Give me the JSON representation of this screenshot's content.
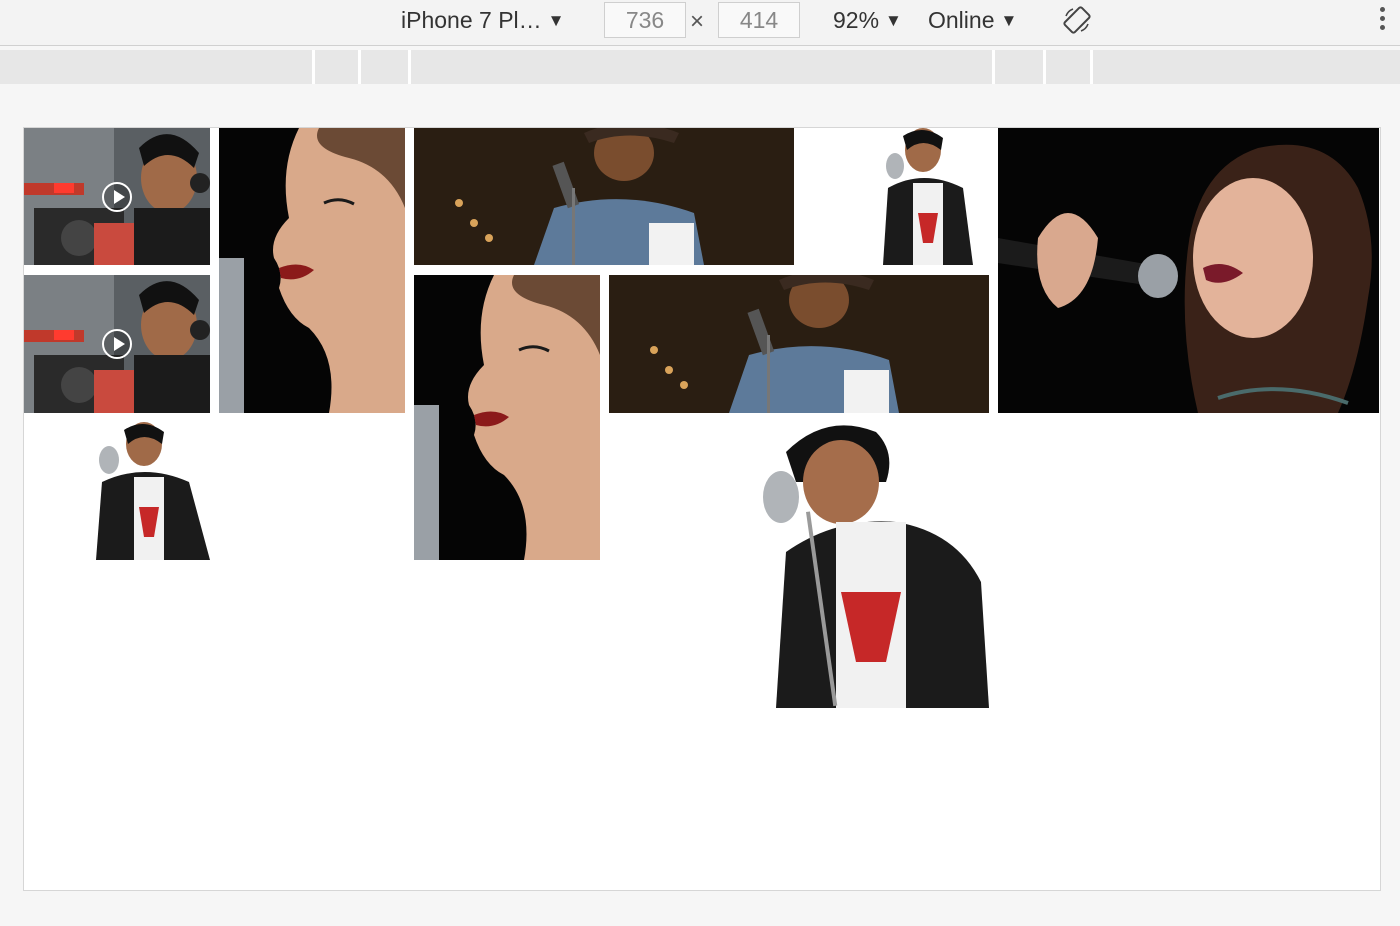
{
  "toolbar": {
    "device": "iPhone 7 Pl…",
    "width": "736",
    "height": "414",
    "times": "×",
    "zoom": "92%",
    "throttle": "Online",
    "arrow": "▼"
  },
  "icons": {
    "rotate": "rotate-icon",
    "more": "kebab-menu-icon",
    "play": "play-icon"
  },
  "colors": {
    "toolbar_bg": "#f3f3f3",
    "ruler_bg": "#e7e7e7",
    "viewport_bg": "#ffffff"
  }
}
